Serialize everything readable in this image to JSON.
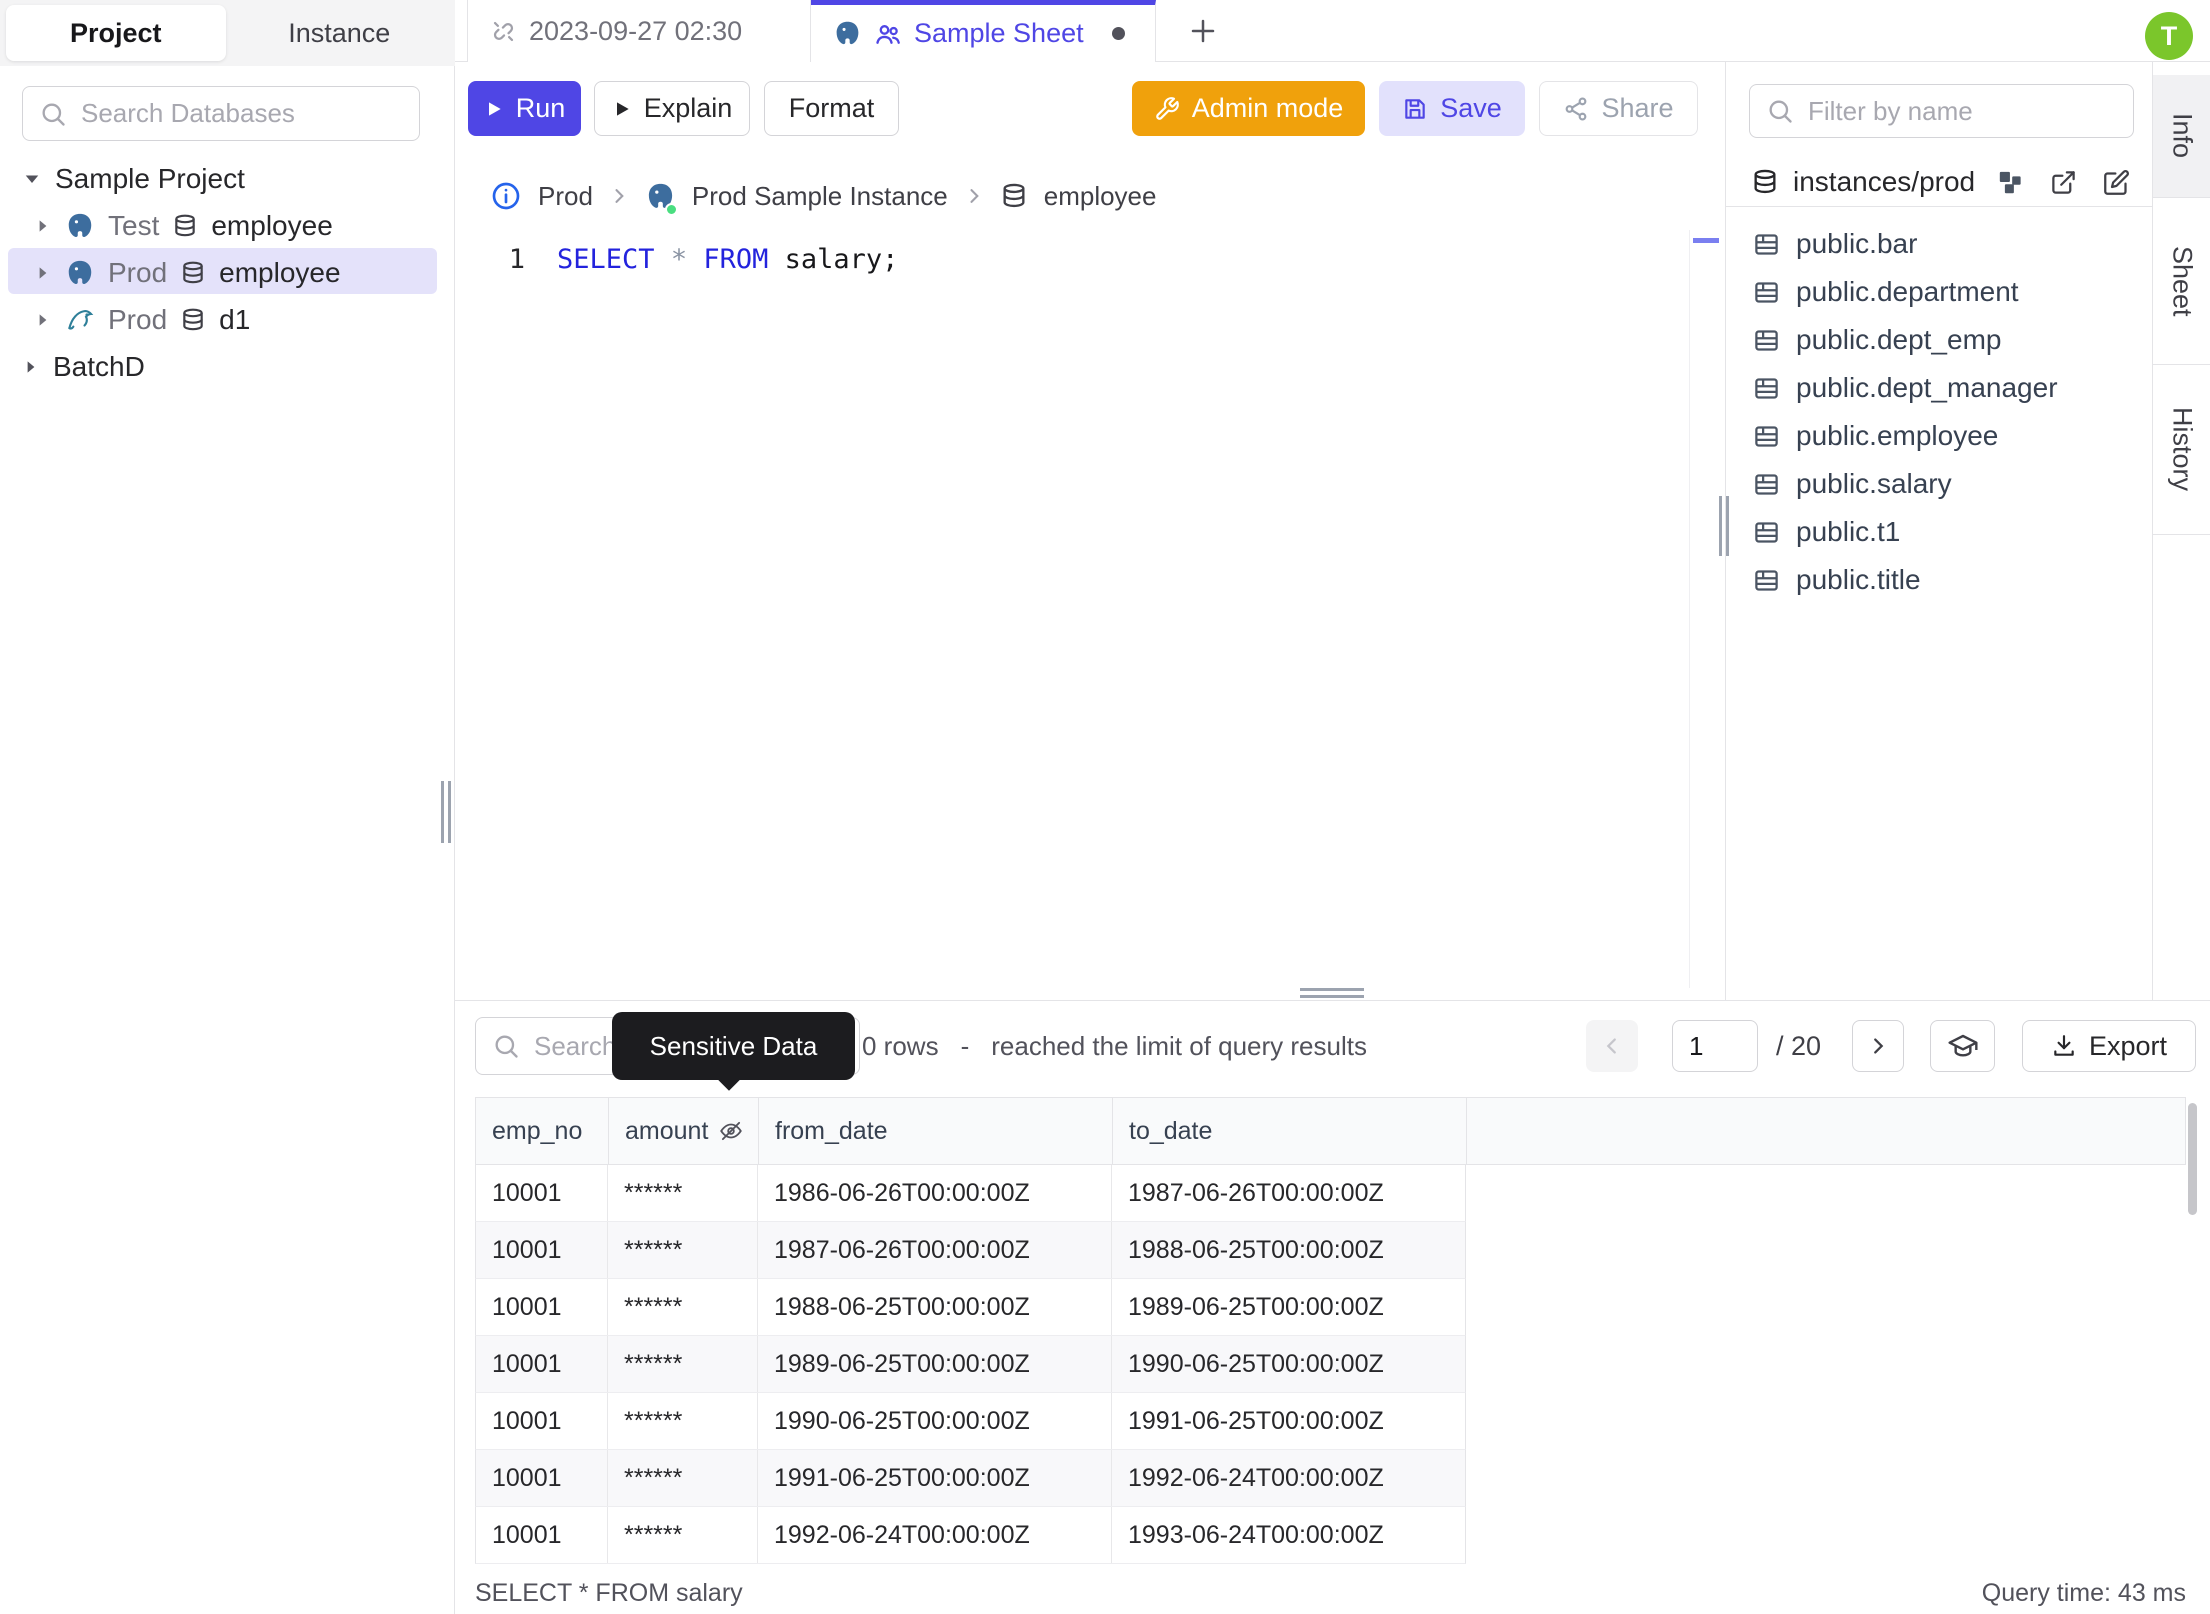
{
  "user": {
    "avatar_initial": "T"
  },
  "sidebar": {
    "tabs": [
      {
        "label": "Project",
        "active": true
      },
      {
        "label": "Instance",
        "active": false
      }
    ],
    "search_placeholder": "Search Databases",
    "tree": {
      "project_label": "Sample Project",
      "items": [
        {
          "engine": "postgres",
          "env": "Test",
          "db": "employee",
          "selected": false
        },
        {
          "engine": "postgres",
          "env": "Prod",
          "db": "employee",
          "selected": true
        },
        {
          "engine": "mysql",
          "env": "Prod",
          "db": "d1",
          "selected": false
        }
      ],
      "batch_label": "BatchD"
    }
  },
  "tab_bar": {
    "tabs": [
      {
        "label": "2023-09-27 02:30",
        "active": false
      },
      {
        "label": "Sample Sheet",
        "active": true,
        "dirty": true
      }
    ]
  },
  "toolbar": {
    "run_label": "Run",
    "explain_label": "Explain",
    "format_label": "Format",
    "admin_mode_label": "Admin mode",
    "save_label": "Save",
    "share_label": "Share"
  },
  "breadcrumb": {
    "environment": "Prod",
    "instance": "Prod Sample Instance",
    "database": "employee"
  },
  "editor": {
    "line_number": "1",
    "sql": {
      "kw1": "SELECT",
      "star": "*",
      "kw2": "FROM",
      "rest": "salary;"
    }
  },
  "schema_panel": {
    "filter_placeholder": "Filter by name",
    "path": "instances/prod",
    "tables": [
      "public.bar",
      "public.department",
      "public.dept_emp",
      "public.dept_manager",
      "public.employee",
      "public.salary",
      "public.t1",
      "public.title"
    ]
  },
  "side_tabs": [
    {
      "label": "Info",
      "active": true
    },
    {
      "label": "Sheet",
      "active": false
    },
    {
      "label": "History",
      "active": false
    }
  ],
  "results": {
    "search_placeholder": "Search",
    "tooltip": "Sensitive Data",
    "rows_count_text": "0 rows",
    "separator": "-",
    "limit_text": "reached the limit of query results",
    "pagination": {
      "page": "1",
      "total": "/ 20"
    },
    "export_label": "Export",
    "table": {
      "headers": [
        "emp_no",
        "amount",
        "from_date",
        "to_date"
      ],
      "rows": [
        [
          "10001",
          "******",
          "1986-06-26T00:00:00Z",
          "1987-06-26T00:00:00Z"
        ],
        [
          "10001",
          "******",
          "1987-06-26T00:00:00Z",
          "1988-06-25T00:00:00Z"
        ],
        [
          "10001",
          "******",
          "1988-06-25T00:00:00Z",
          "1989-06-25T00:00:00Z"
        ],
        [
          "10001",
          "******",
          "1989-06-25T00:00:00Z",
          "1990-06-25T00:00:00Z"
        ],
        [
          "10001",
          "******",
          "1990-06-25T00:00:00Z",
          "1991-06-25T00:00:00Z"
        ],
        [
          "10001",
          "******",
          "1991-06-25T00:00:00Z",
          "1992-06-24T00:00:00Z"
        ],
        [
          "10001",
          "******",
          "1992-06-24T00:00:00Z",
          "1993-06-24T00:00:00Z"
        ]
      ]
    },
    "status_left": "SELECT * FROM salary",
    "status_right": "Query time: 43 ms"
  },
  "icons": {
    "search-icon": "magnifier",
    "unlink-icon": "broken chain link",
    "users-icon": "people group",
    "postgres-icon": "postgresql elephant",
    "mysql-icon": "mysql dolphin",
    "database-icon": "db cylinder",
    "table-icon": "grid table",
    "play-icon": "triangle",
    "wrench-icon": "wrench",
    "floppy-icon": "save disk",
    "share-icon": "share nodes",
    "info-icon": "circled i",
    "chevron-right-icon": "›",
    "chevron-left-icon": "‹",
    "eye-off-icon": "masked column",
    "schema-diagram-icon": "linked blocks",
    "external-link-icon": "open in new",
    "edit-icon": "pencil square",
    "download-icon": "download tray",
    "mortarboard-icon": "graduation cap",
    "plus-icon": "+",
    "caret-down-icon": "▾",
    "caret-right-icon": "▸"
  },
  "colors": {
    "accent": "#4f46e5",
    "admin_orange": "#f0a10c",
    "selection": "#e4e2fa",
    "avatar_green": "#7bc62b",
    "status_green": "#4ade80",
    "keyword_blue": "#2323dd",
    "tooltip_bg": "#1c1c1f"
  }
}
